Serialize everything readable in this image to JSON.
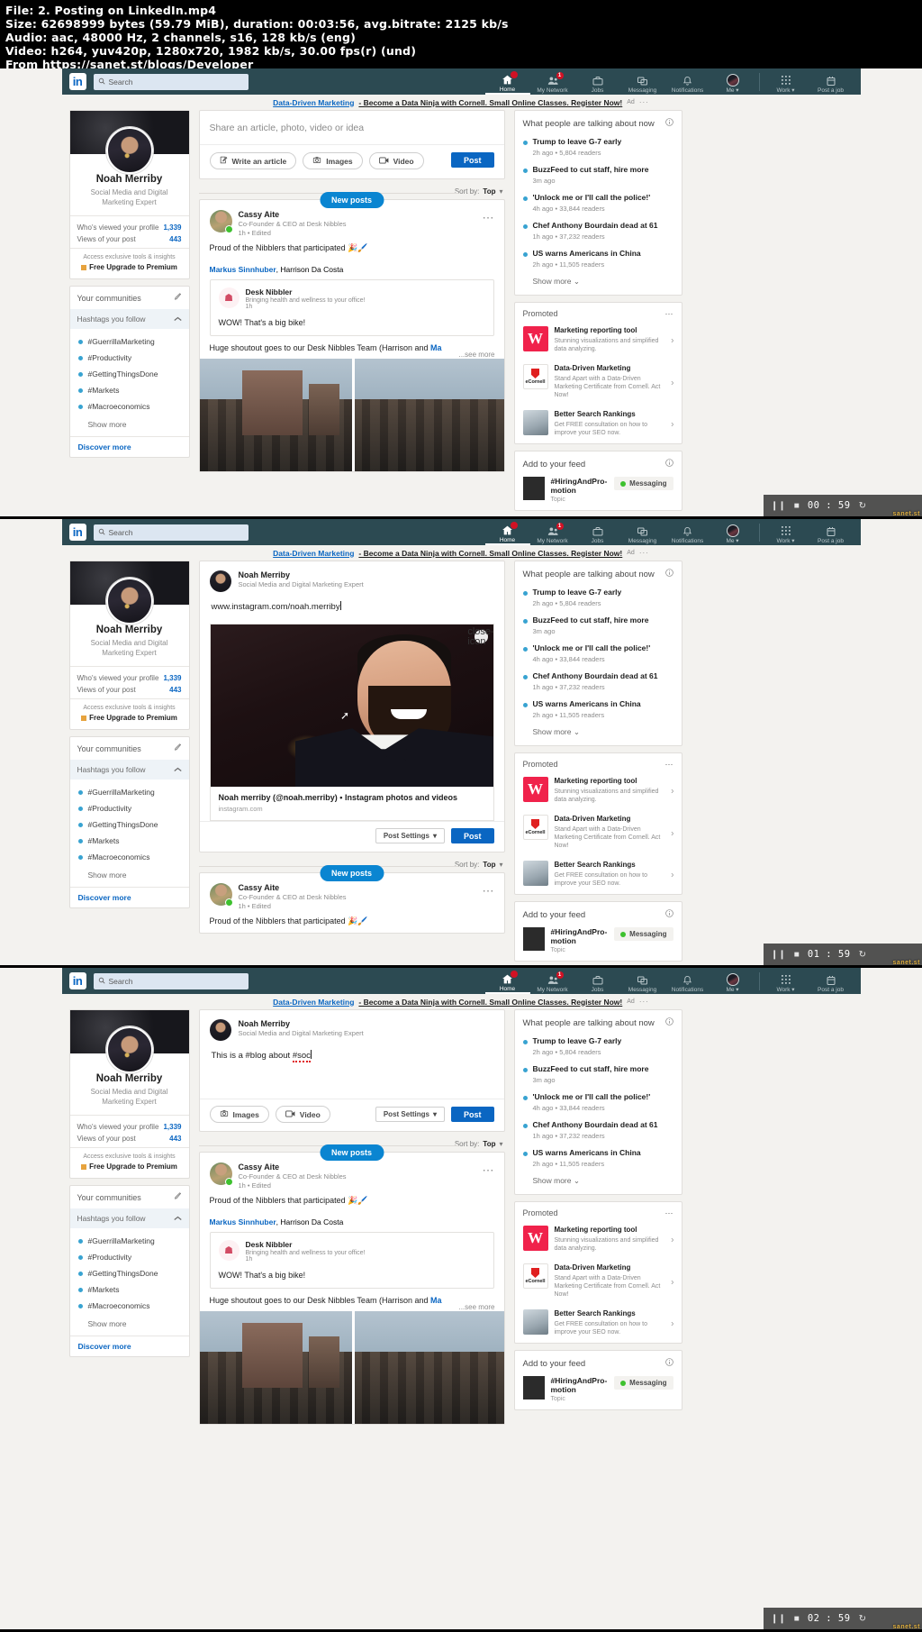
{
  "file_info": {
    "line1": "File: 2. Posting on LinkedIn.mp4",
    "line2": "Size: 62698999 bytes (59.79 MiB), duration: 00:03:56, avg.bitrate: 2125 kb/s",
    "line3": "Audio: aac, 48000 Hz, 2 channels, s16, 128 kb/s (eng)",
    "line4": "Video: h264, yuv420p, 1280x720, 1982 kb/s, 30.00 fps(r) (und)",
    "line5": "From https://sanet.st/blogs/Developer"
  },
  "topbar": {
    "logo": "in",
    "search_placeholder": "Search",
    "nav": [
      {
        "label": "Home",
        "icon": "home-icon",
        "badge": "",
        "active": true
      },
      {
        "label": "My Network",
        "icon": "network-icon",
        "badge": "1",
        "active": false
      },
      {
        "label": "Jobs",
        "icon": "briefcase-icon",
        "badge": "",
        "active": false
      },
      {
        "label": "Messaging",
        "icon": "messaging-icon",
        "badge": "",
        "active": false
      },
      {
        "label": "Notifications",
        "icon": "bell-icon",
        "badge": "",
        "active": false
      },
      {
        "label": "Me ▾",
        "icon": "avatar-icon",
        "badge": "",
        "active": false
      }
    ],
    "nav_right": [
      {
        "label": "Work ▾",
        "icon": "grid-icon"
      },
      {
        "label": "Post a job",
        "icon": "postjob-icon"
      }
    ]
  },
  "ad": {
    "link": "Data-Driven Marketing",
    "text": "- Become a Data Ninja with Cornell. Small Online Classes. Register Now!",
    "tag": "Ad",
    "dots": "···"
  },
  "profile": {
    "name": "Noah Merriby",
    "title": "Social Media and Digital Marketing Expert",
    "stats": [
      {
        "label": "Who's viewed your profile",
        "value": "1,339"
      },
      {
        "label": "Views of your post",
        "value": "443"
      }
    ],
    "premium_sub": "Access exclusive tools & insights",
    "premium_link": "Free Upgrade to Premium"
  },
  "communities": {
    "header": "Your communities",
    "edit_icon": "pencil-icon",
    "hashtags_header": "Hashtags you follow",
    "collapse_icon": "chevron-up-icon",
    "items": [
      "#GuerrillaMarketing",
      "#Productivity",
      "#GettingThingsDone",
      "#Markets",
      "#Macroeconomics"
    ],
    "show_more": "Show more",
    "discover_more": "Discover more"
  },
  "share_box": {
    "placeholder": "Share an article, photo, video or idea",
    "actions": [
      {
        "label": "Write an article",
        "icon": "article-icon"
      },
      {
        "label": "Images",
        "icon": "camera-icon"
      },
      {
        "label": "Video",
        "icon": "video-icon"
      }
    ],
    "post_label": "Post"
  },
  "sort": {
    "label": "Sort by:",
    "value": "Top",
    "caret": "▾"
  },
  "feed_post": {
    "new_posts_label": "New posts",
    "author": "Cassy Aite",
    "author_sub": "Co-Founder & CEO at Desk Nibbles",
    "time": "1h • Edited",
    "text": "Proud of the Nibblers that participated 🎉🖌️",
    "more_icon": "more-options-icon",
    "shared_by_name": "Markus Sinnhuber",
    "shared_by_rest": ", Harrison Da Costa",
    "shared_author": "Desk Nibbler",
    "shared_author_sub": "Bringing health and wellness to your office!",
    "shared_time": "1h",
    "shared_text": "WOW! That's a big bike!",
    "caption": "Huge shoutout goes to our Desk Nibbles Team (Harrison and ",
    "caption_mention": "Ma",
    "see_more": "...see more"
  },
  "right_rail": {
    "news_header": "What people are talking about now",
    "info_icon": "info-icon",
    "news": [
      {
        "title": "Trump to leave G-7 early",
        "meta": "2h ago • 5,804 readers"
      },
      {
        "title": "BuzzFeed to cut staff, hire more",
        "meta": "3m ago"
      },
      {
        "title": "'Unlock me or I'll call the police!'",
        "meta": "4h ago • 33,844 readers"
      },
      {
        "title": "Chef Anthony Bourdain dead at 61",
        "meta": "1h ago • 37,232 readers"
      },
      {
        "title": "US warns Americans in China",
        "meta": "2h ago • 11,505 readers"
      }
    ],
    "show_more": "Show more",
    "show_more_caret": "⌄",
    "promoted_header": "Promoted",
    "promoted_dots": "···",
    "promoted": [
      {
        "logo": "wistia-logo",
        "title": "Marketing reporting tool",
        "sub": "Stunning visualizations and simplified data analyzing."
      },
      {
        "logo": "ecornell-logo",
        "title": "Data-Driven Marketing",
        "sub": "Stand Apart with a Data-Driven Marketing Certificate from Cornell. Act Now!"
      },
      {
        "logo": "seo-logo",
        "title": "Better Search Rankings",
        "sub": "Get FREE consultation on how to improve your SEO now."
      }
    ],
    "feed_header": "Add to your feed",
    "feed_items": [
      {
        "title": "#HiringAndPro-motion",
        "sub": "Topic",
        "action": "Messaging"
      }
    ]
  },
  "compose_url": {
    "name": "Noah Merriby",
    "sub": "Social Media and Digital Marketing Expert",
    "text": "www.instagram.com/noah.merriby",
    "preview_title": "Noah merriby (@noah.merriby) • Instagram photos and videos",
    "preview_domain": "instagram.com",
    "close_icon": "close-icon",
    "settings_label": "Post Settings",
    "settings_caret": "▾",
    "post_label": "Post"
  },
  "compose_hashtag": {
    "name": "Noah Merriby",
    "sub": "Social Media and Digital Marketing Expert",
    "text_plain1": "This is a ",
    "text_tag1": "#blog",
    "text_plain2": " about ",
    "text_tag2": "#soc",
    "actions": [
      {
        "label": "Images",
        "icon": "camera-icon"
      },
      {
        "label": "Video",
        "icon": "video-icon"
      }
    ],
    "settings_label": "Post Settings",
    "settings_caret": "▾",
    "post_label": "Post"
  },
  "video_controls": [
    {
      "pause_icon": "pause-icon",
      "stop_icon": "stop-icon",
      "time": "00 : 59",
      "loop_icon": "loop-icon",
      "watermark": "sanet.st"
    },
    {
      "pause_icon": "pause-icon",
      "stop_icon": "stop-icon",
      "time": "01 : 59",
      "loop_icon": "loop-icon",
      "watermark": "sanet.st"
    },
    {
      "pause_icon": "pause-icon",
      "stop_icon": "stop-icon",
      "time": "02 : 59",
      "loop_icon": "loop-icon",
      "watermark": "sanet.st"
    }
  ],
  "colors": {
    "linkedin_blue": "#0a66c2",
    "topbar": "#2c4a52",
    "page_bg": "#f3f2ef",
    "badge_red": "#d11124",
    "new_posts": "#0a85d1"
  }
}
